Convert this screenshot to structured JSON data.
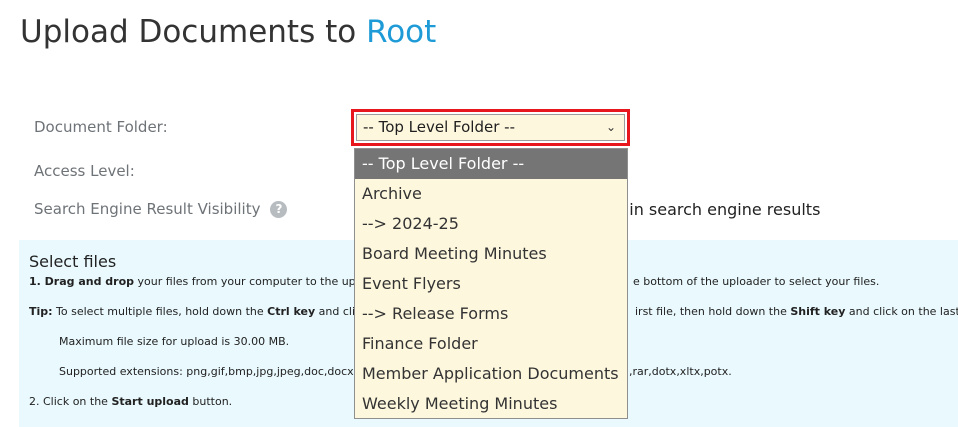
{
  "page": {
    "title_prefix": "Upload Documents to ",
    "title_accent": "Root"
  },
  "form": {
    "folder_label": "Document Folder:",
    "access_label": "Access Level:",
    "seo_label": "Search Engine Result Visibility",
    "seo_help_icon": "?",
    "seo_value_partial": "g in search engine results",
    "folder_select": {
      "value": "-- Top Level Folder --",
      "chevron": "⌄",
      "options": [
        "-- Top Level Folder --",
        "Archive",
        "--> 2024-25",
        "Board Meeting Minutes",
        "Event Flyers",
        "--> Release Forms",
        "Finance Folder",
        "Member Application Documents",
        "Weekly Meeting Minutes"
      ]
    }
  },
  "uploader": {
    "title": "Select files",
    "step1_num": "1. ",
    "step1_bold": "Drag and drop",
    "step1_text": " your files from your computer to the upload",
    "step1_tail": "e bottom of the uploader to select your files.",
    "tip_bold": "Tip:",
    "tip_text": " To select multiple files, hold down the ",
    "tip_ctrl": "Ctrl key",
    "tip_text2": " and click",
    "tip_tail": "irst file, then hold down the ",
    "tip_shift": "Shift key",
    "tip_tail2": " and click on the last file.",
    "max_size": "Maximum file size for upload is 30.00 MB.",
    "extensions_head": "Supported extensions: png,gif,bmp,jpg,jpeg,doc,docx,xl",
    "extensions_tail": ",rar,dotx,xltx,potx.",
    "step2_text": "2. Click on the ",
    "step2_bold": "Start upload",
    "step2_tail": " button."
  }
}
